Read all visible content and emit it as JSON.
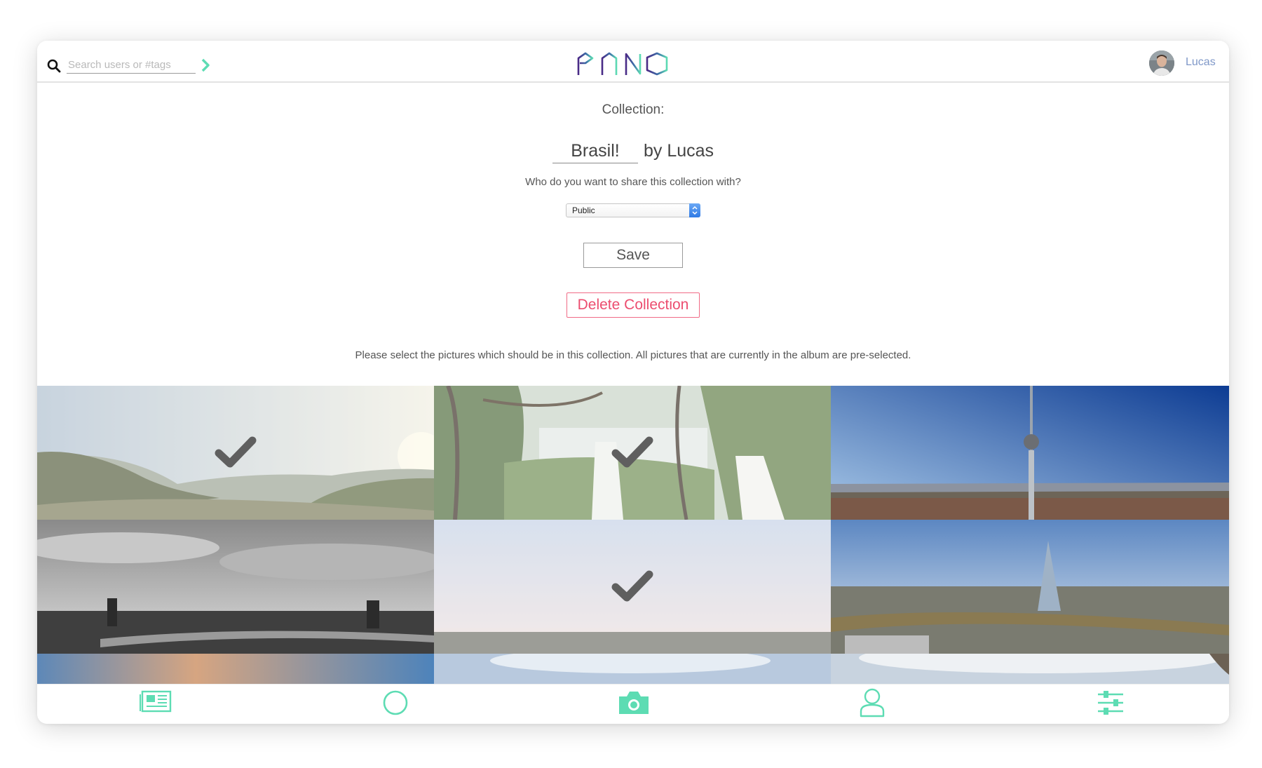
{
  "header": {
    "search_placeholder": "Search users or #tags",
    "logo_text": "PANO",
    "user_name": "Lucas"
  },
  "form": {
    "collection_label": "Collection:",
    "collection_name": "Brasil!",
    "owner_label": "by Lucas",
    "share_question": "Who do you want to share this collection with?",
    "share_selected": "Public",
    "save_label": "Save",
    "delete_label": "Delete Collection",
    "instructions": "Please select the pictures which should be in this collection. All pictures that are currently in the album are pre-selected."
  },
  "photos": [
    {
      "scene": "misty-hills-sunrise",
      "selected": true
    },
    {
      "scene": "jungle-waterfall",
      "selected": true
    },
    {
      "scene": "tv-tower-city",
      "selected": false
    },
    {
      "scene": "black-white-city-river",
      "selected": false
    },
    {
      "scene": "hazy-horizon-dusk",
      "selected": true
    },
    {
      "scene": "shard-river-city",
      "selected": false
    },
    {
      "scene": "sunset-clouds",
      "selected": false
    },
    {
      "scene": "pale-sky",
      "selected": false
    },
    {
      "scene": "bright-sky-tree",
      "selected": false
    }
  ],
  "nav": {
    "items": [
      {
        "icon": "newspaper-icon",
        "label": "feed"
      },
      {
        "icon": "circle-icon",
        "label": "explore"
      },
      {
        "icon": "camera-icon",
        "label": "upload"
      },
      {
        "icon": "user-icon",
        "label": "profile"
      },
      {
        "icon": "sliders-icon",
        "label": "settings"
      }
    ]
  },
  "colors": {
    "accent": "#5ddcb3",
    "danger": "#ec4d6f",
    "link": "#7f98c8",
    "logo_purple": "#4a2a86",
    "logo_teal": "#5ddcb3"
  }
}
